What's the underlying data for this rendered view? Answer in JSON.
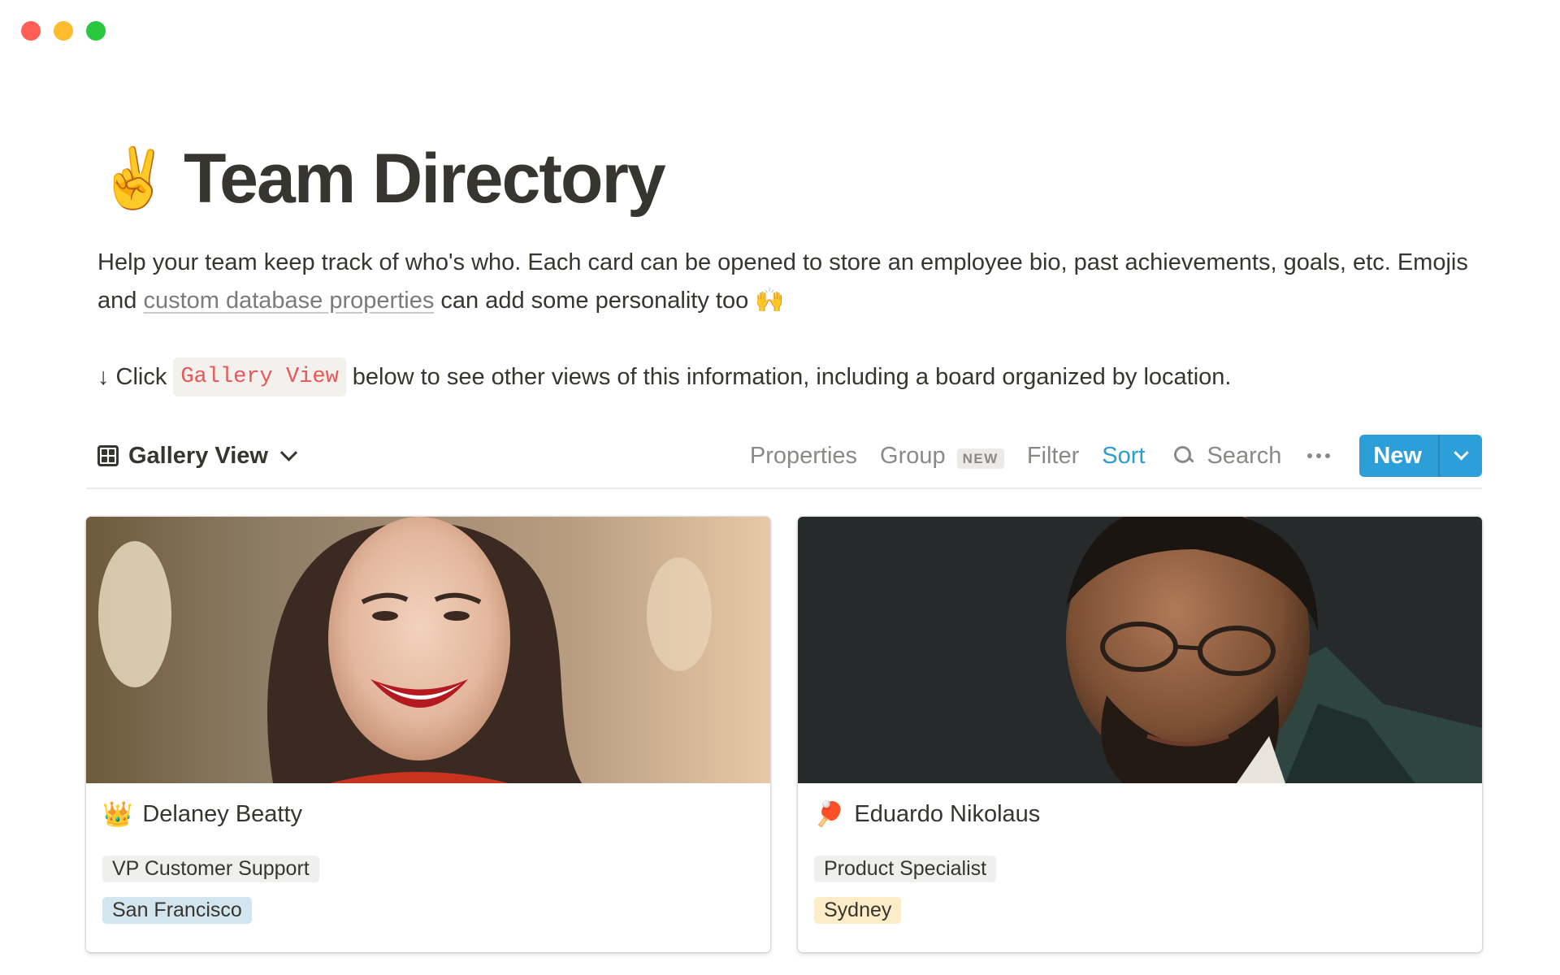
{
  "page": {
    "title_emoji": "✌️",
    "title": "Team Directory",
    "description_part1": "Help your team keep track of who's who. Each card can be opened to store an employee bio, past achievements, goals, etc. Emojis and ",
    "description_link": "custom database properties",
    "description_part2": " can add some personality too",
    "description_emoji": "🙌",
    "callout_arrow": "↓",
    "callout_pre": "Click",
    "callout_code": "Gallery View",
    "callout_post": "below to see other views of this information, including a board organized by location."
  },
  "toolbar": {
    "view_icon": "gallery-grid-icon",
    "view_label": "Gallery View",
    "properties_label": "Properties",
    "group_label": "Group",
    "group_badge": "NEW",
    "filter_label": "Filter",
    "sort_label": "Sort",
    "search_label": "Search",
    "new_label": "New",
    "accent_color": "#2c9fd9",
    "sort_color": "#2b9bd3"
  },
  "cards": [
    {
      "emoji": "👑",
      "name": "Delaney Beatty",
      "role": "VP Customer Support",
      "location": "San Francisco",
      "location_color": "#d3e5ef"
    },
    {
      "emoji": "🏓",
      "name": "Eduardo Nikolaus",
      "role": "Product Specialist",
      "location": "Sydney",
      "location_color": "#fdecc8"
    }
  ]
}
